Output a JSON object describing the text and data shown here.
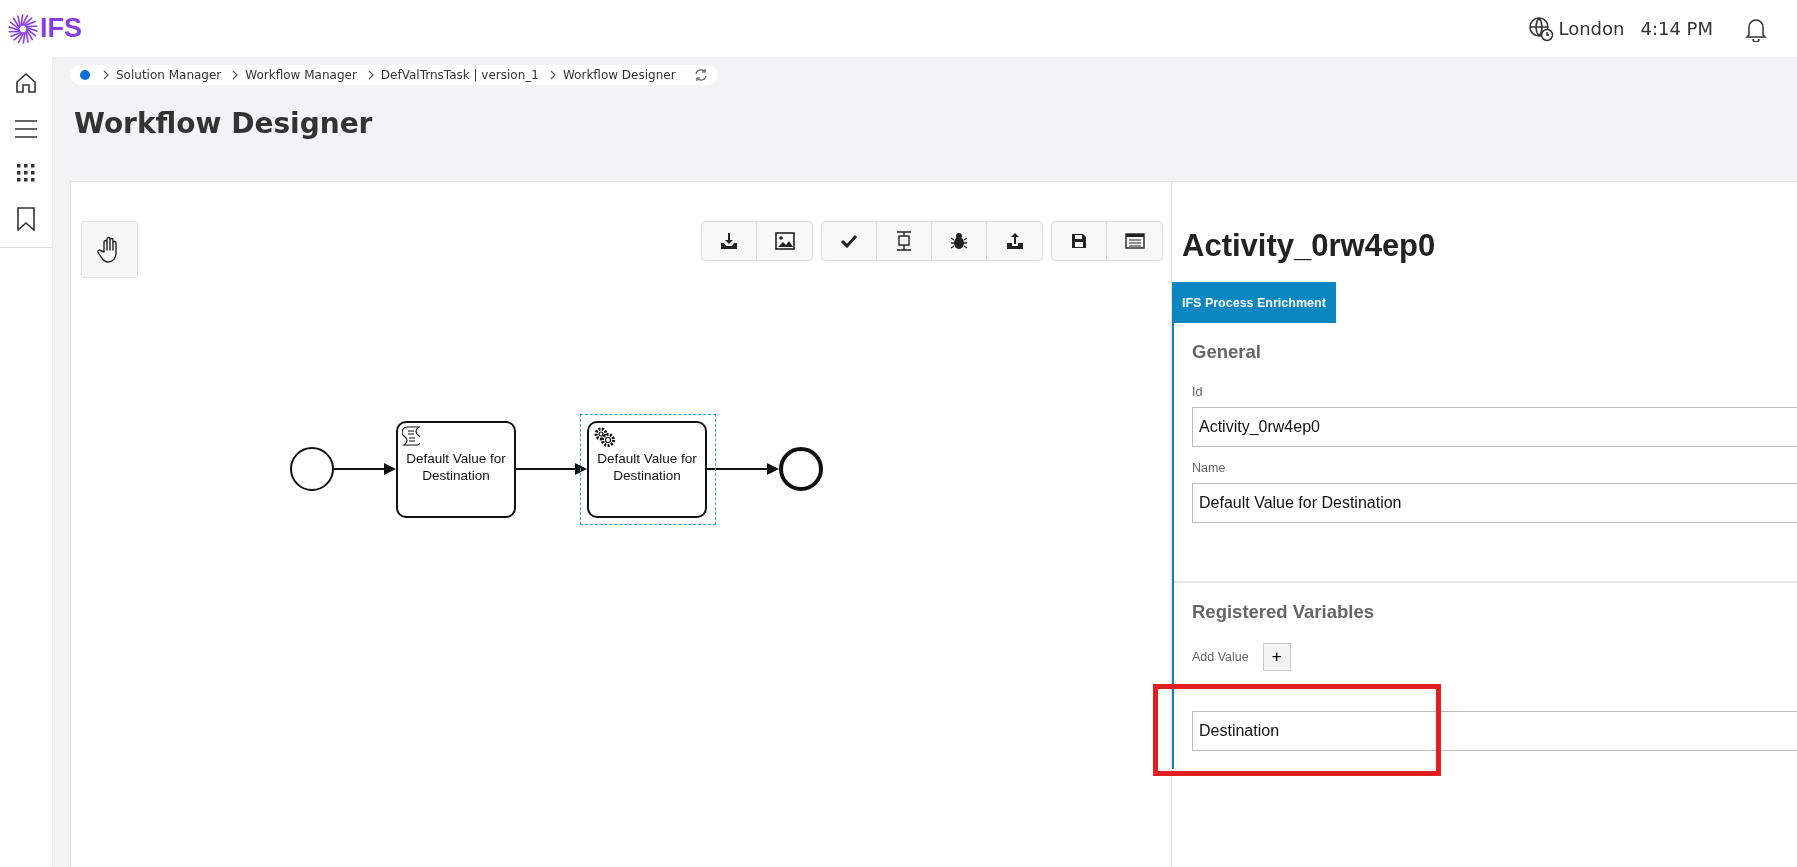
{
  "header": {
    "logo": "IFS",
    "location": "London",
    "time": "4:14 PM"
  },
  "breadcrumb": [
    "Solution Manager",
    "Workflow Manager",
    "DefValTrnsTask | version_1",
    "Workflow Designer"
  ],
  "page_title": "Workflow Designer",
  "diagram": {
    "nodes": [
      {
        "kind": "start"
      },
      {
        "kind": "script_task",
        "label": "Default Value for Destination",
        "selected": false
      },
      {
        "kind": "service_task",
        "label": "Default Value for Destination",
        "selected": true
      },
      {
        "kind": "end"
      }
    ]
  },
  "properties": {
    "title": "Activity_0rw4ep0",
    "tabs": [
      {
        "label": "IFS Process Enrichment",
        "selected": true
      }
    ],
    "general": {
      "heading": "General",
      "fields": [
        {
          "label": "Id",
          "value": "Activity_0rw4ep0"
        },
        {
          "label": "Name",
          "value": "Default Value for Destination"
        }
      ]
    },
    "registered_variables": {
      "heading": "Registered Variables",
      "add_label": "Add Value",
      "add_button": "+",
      "variables": [
        {
          "value": "Destination"
        }
      ]
    }
  }
}
